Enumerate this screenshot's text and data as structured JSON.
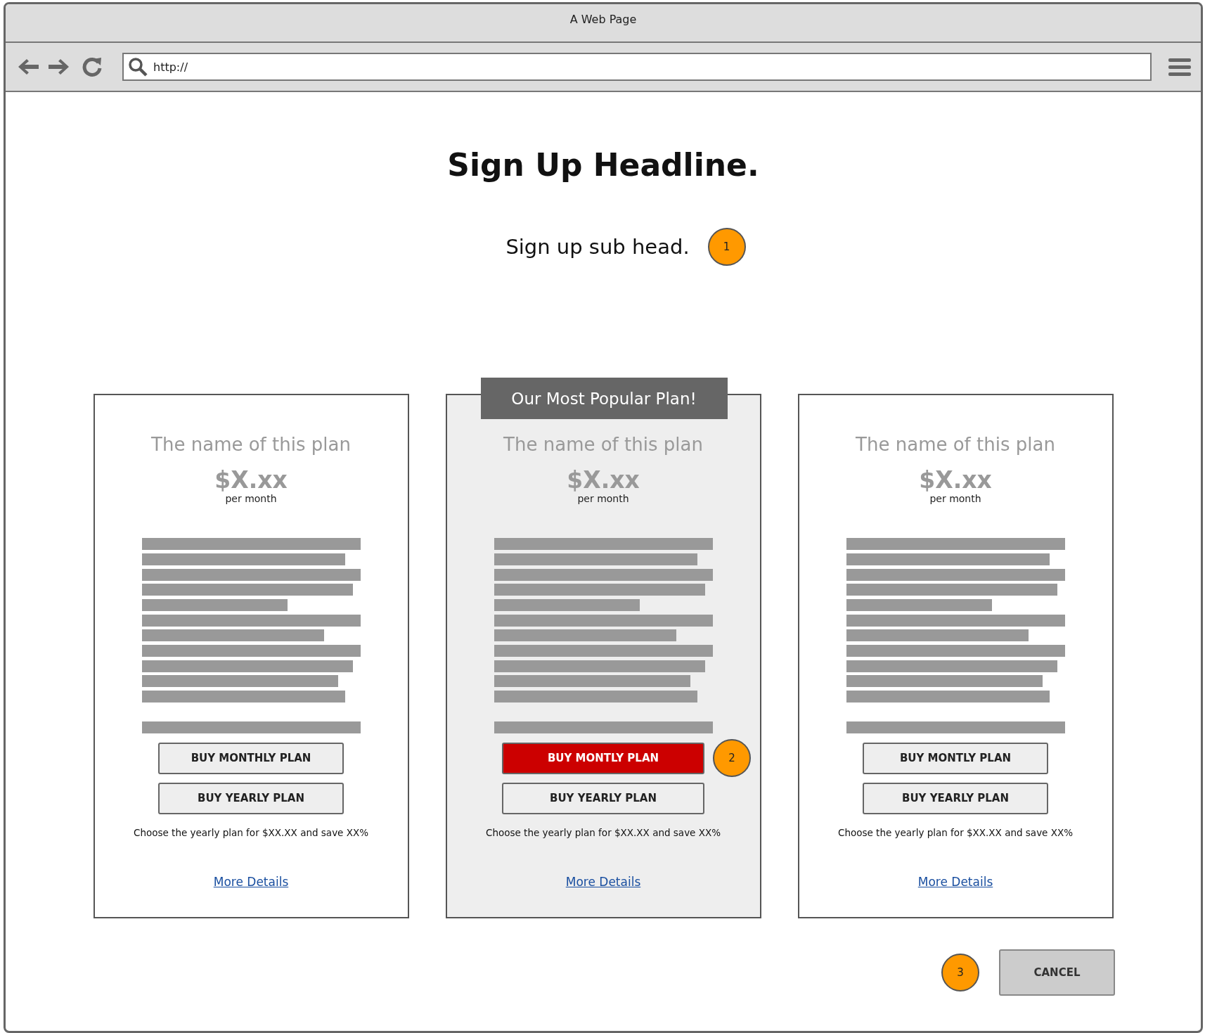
{
  "window": {
    "title": "A Web Page"
  },
  "address_bar": {
    "value": "http://"
  },
  "headline": "Sign Up Headline.",
  "subhead": {
    "text": "Sign up sub head.",
    "badge": "1"
  },
  "plans": [
    {
      "featured": false,
      "name": "The name of this plan",
      "price": "$X.xx",
      "period": "per month",
      "buttons": [
        {
          "label": "BUY MONTHLY PLAN",
          "primary": false
        },
        {
          "label": "BUY YEARLY PLAN",
          "primary": false
        }
      ],
      "note": "Choose the yearly plan for $XX.XX and save XX%",
      "link": "More Details"
    },
    {
      "featured": true,
      "banner": "Our Most Popular Plan!",
      "badge": "2",
      "name": "The name of this plan",
      "price": "$X.xx",
      "period": "per month",
      "buttons": [
        {
          "label": "BUY MONTLY PLAN",
          "primary": true
        },
        {
          "label": "BUY YEARLY PLAN",
          "primary": false
        }
      ],
      "note": "Choose the yearly plan for $XX.XX and save XX%",
      "link": "More Details"
    },
    {
      "featured": false,
      "name": "The name of this plan",
      "price": "$X.xx",
      "period": "per month",
      "buttons": [
        {
          "label": "BUY MONTLY PLAN",
          "primary": false
        },
        {
          "label": "BUY YEARLY PLAN",
          "primary": false
        }
      ],
      "note": "Choose the yearly plan for $XX.XX and save XX%",
      "link": "More Details"
    }
  ],
  "footer": {
    "badge": "3",
    "cancel": "CANCEL"
  }
}
